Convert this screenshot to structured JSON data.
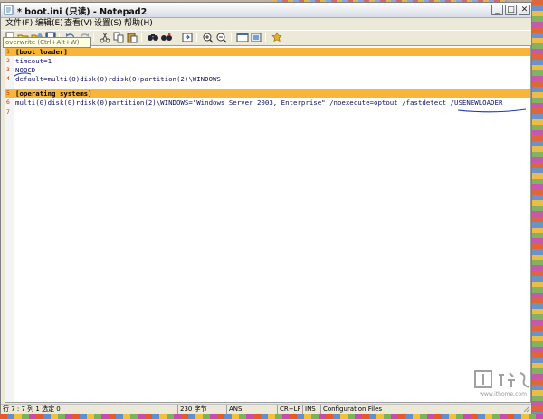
{
  "window": {
    "title": "* boot.ini (只读) - Notepad2"
  },
  "title_buttons": [
    "_",
    "□",
    "✕"
  ],
  "menu": [
    {
      "label": "文件(F)"
    },
    {
      "label": "编辑(E)"
    },
    {
      "label": "查看(V)"
    },
    {
      "label": "设置(S)"
    },
    {
      "label": "帮助(H)"
    }
  ],
  "toolbar": {
    "buttons": [
      "new-icon",
      "open-icon",
      "browse-icon",
      "save-icon",
      "undo-icon",
      "redo-icon",
      "cut-icon",
      "copy-icon",
      "paste-icon",
      "find-icon",
      "replace-icon",
      "goto-icon",
      "zoom-in-icon",
      "zoom-out-icon",
      "view-scheme-icon",
      "customize-icon",
      "settings-icon"
    ],
    "tooltip": "overwrite (Ctrl+Alt+W)"
  },
  "editor": {
    "lines": [
      {
        "num": "1",
        "text": "[boot loader]",
        "kind": "section"
      },
      {
        "num": "2",
        "text": "timeout=1",
        "kind": "key"
      },
      {
        "num": "3",
        "text": "NOBCD",
        "kind": "key"
      },
      {
        "num": "4",
        "text": "default=multi(0)disk(0)rdisk(0)partition(2)\\WINDOWS",
        "kind": "key"
      },
      {
        "num": "5",
        "text": "[operating systems]",
        "kind": "section"
      },
      {
        "num": "6",
        "text": "multi(0)disk(0)rdisk(0)partition(2)\\WINDOWS=\"Windows Server 2003, Enterprise\" /noexecute=optout /fastdetect /USENEWLOADER",
        "kind": "key"
      },
      {
        "num": "7",
        "text": "",
        "kind": "key"
      }
    ],
    "section_color": "#f8b53a"
  },
  "statusbar": {
    "position": "行 7 : 7  列 1  选定 0",
    "size": "230 字节",
    "encoding": "ANSI",
    "eol": "CR+LF",
    "ovr": "INS",
    "scheme": "Configuration Files"
  },
  "watermark": {
    "text": "www.ithome.com"
  }
}
